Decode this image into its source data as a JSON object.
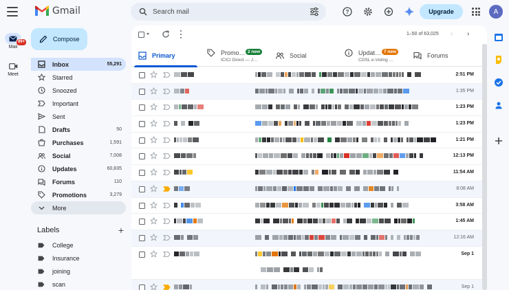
{
  "app": {
    "logo_text": "Gmail"
  },
  "search": {
    "placeholder": "Search mail"
  },
  "header": {
    "upgrade_label": "Upgrade",
    "avatar_letter": "A"
  },
  "rail": [
    {
      "label": "Mail",
      "badge": "99+"
    },
    {
      "label": "Meet"
    }
  ],
  "compose_label": "Compose",
  "nav": [
    {
      "label": "Inbox",
      "count": "55,291",
      "icon": "inbox-icon",
      "active": true
    },
    {
      "label": "Starred",
      "count": "",
      "icon": "star-icon"
    },
    {
      "label": "Snoozed",
      "count": "",
      "icon": "clock-icon"
    },
    {
      "label": "Important",
      "count": "",
      "icon": "important-icon"
    },
    {
      "label": "Sent",
      "count": "",
      "icon": "send-icon"
    },
    {
      "label": "Drafts",
      "count": "50",
      "icon": "draft-icon",
      "bold": true
    },
    {
      "label": "Purchases",
      "count": "1,591",
      "icon": "purchases-icon",
      "bold": true
    },
    {
      "label": "Social",
      "count": "7,008",
      "icon": "social-icon",
      "bold": true
    },
    {
      "label": "Updates",
      "count": "60,835",
      "icon": "updates-icon",
      "bold": true
    },
    {
      "label": "Forums",
      "count": "110",
      "icon": "forums-icon",
      "bold": true
    },
    {
      "label": "Promotions",
      "count": "3,279",
      "icon": "promotions-icon",
      "bold": true
    },
    {
      "label": "More",
      "count": "",
      "icon": "chevron-down-icon"
    }
  ],
  "labels_section": {
    "title": "Labels",
    "items": [
      "College",
      "Insurance",
      "joining",
      "scan"
    ]
  },
  "pager": {
    "text": "1–50 of 63,025"
  },
  "tabs": [
    {
      "label": "Primary",
      "icon": "inbox-tab-icon",
      "active": true,
      "badge": "",
      "sub": ""
    },
    {
      "label": "Promo…",
      "icon": "tag-icon",
      "badge": "2 new",
      "badge_color": "#188038",
      "sub": "ICICI Direct — J…"
    },
    {
      "label": "Social",
      "icon": "people-icon",
      "badge": "",
      "sub": ""
    },
    {
      "label": "Updat…",
      "icon": "info-icon",
      "badge": "7 new",
      "badge_color": "#e37400",
      "sub": "CDSL e-Voting …"
    },
    {
      "label": "Forums",
      "icon": "forum-icon",
      "badge": "",
      "sub": ""
    }
  ],
  "emails": [
    {
      "time": "2:51 PM",
      "unread": true
    },
    {
      "time": "1:35 PM",
      "unread": false
    },
    {
      "time": "1:23 PM",
      "unread": true
    },
    {
      "time": "1:23 PM",
      "unread": true
    },
    {
      "time": "1:21 PM",
      "unread": true
    },
    {
      "time": "12:13 PM",
      "unread": true
    },
    {
      "time": "11:54 AM",
      "unread": true
    },
    {
      "time": "8:08 AM",
      "unread": false,
      "important": true
    },
    {
      "time": "3:58 AM",
      "unread": true
    },
    {
      "time": "1:45 AM",
      "unread": true
    },
    {
      "time": "12:16 AM",
      "unread": false
    },
    {
      "time": "Sep 1",
      "unread": true,
      "tall": true
    },
    {
      "time": "Sep 1",
      "unread": false,
      "important": true
    }
  ]
}
